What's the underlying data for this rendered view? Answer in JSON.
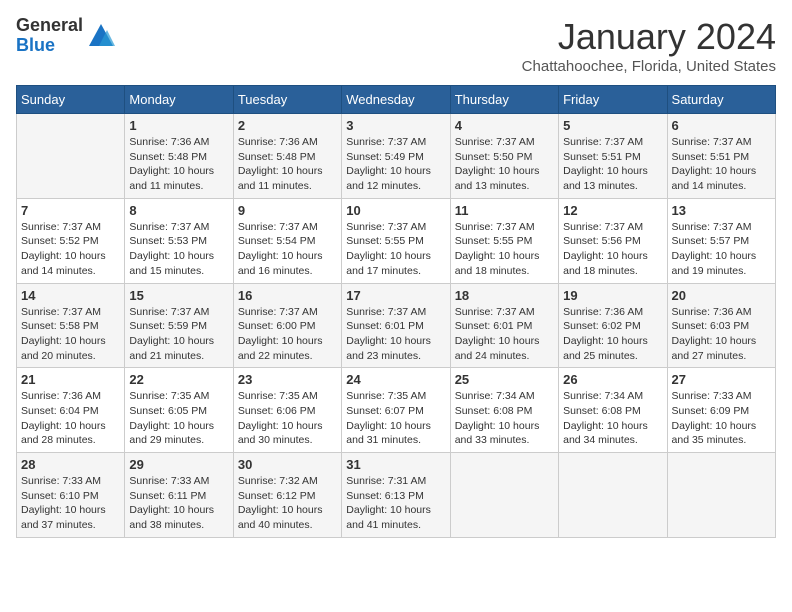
{
  "logo": {
    "general": "General",
    "blue": "Blue"
  },
  "title": "January 2024",
  "location": "Chattahoochee, Florida, United States",
  "days_of_week": [
    "Sunday",
    "Monday",
    "Tuesday",
    "Wednesday",
    "Thursday",
    "Friday",
    "Saturday"
  ],
  "weeks": [
    [
      {
        "day": "",
        "info": ""
      },
      {
        "day": "1",
        "info": "Sunrise: 7:36 AM\nSunset: 5:48 PM\nDaylight: 10 hours\nand 11 minutes."
      },
      {
        "day": "2",
        "info": "Sunrise: 7:36 AM\nSunset: 5:48 PM\nDaylight: 10 hours\nand 11 minutes."
      },
      {
        "day": "3",
        "info": "Sunrise: 7:37 AM\nSunset: 5:49 PM\nDaylight: 10 hours\nand 12 minutes."
      },
      {
        "day": "4",
        "info": "Sunrise: 7:37 AM\nSunset: 5:50 PM\nDaylight: 10 hours\nand 13 minutes."
      },
      {
        "day": "5",
        "info": "Sunrise: 7:37 AM\nSunset: 5:51 PM\nDaylight: 10 hours\nand 13 minutes."
      },
      {
        "day": "6",
        "info": "Sunrise: 7:37 AM\nSunset: 5:51 PM\nDaylight: 10 hours\nand 14 minutes."
      }
    ],
    [
      {
        "day": "7",
        "info": "Sunrise: 7:37 AM\nSunset: 5:52 PM\nDaylight: 10 hours\nand 14 minutes."
      },
      {
        "day": "8",
        "info": "Sunrise: 7:37 AM\nSunset: 5:53 PM\nDaylight: 10 hours\nand 15 minutes."
      },
      {
        "day": "9",
        "info": "Sunrise: 7:37 AM\nSunset: 5:54 PM\nDaylight: 10 hours\nand 16 minutes."
      },
      {
        "day": "10",
        "info": "Sunrise: 7:37 AM\nSunset: 5:55 PM\nDaylight: 10 hours\nand 17 minutes."
      },
      {
        "day": "11",
        "info": "Sunrise: 7:37 AM\nSunset: 5:55 PM\nDaylight: 10 hours\nand 18 minutes."
      },
      {
        "day": "12",
        "info": "Sunrise: 7:37 AM\nSunset: 5:56 PM\nDaylight: 10 hours\nand 18 minutes."
      },
      {
        "day": "13",
        "info": "Sunrise: 7:37 AM\nSunset: 5:57 PM\nDaylight: 10 hours\nand 19 minutes."
      }
    ],
    [
      {
        "day": "14",
        "info": "Sunrise: 7:37 AM\nSunset: 5:58 PM\nDaylight: 10 hours\nand 20 minutes."
      },
      {
        "day": "15",
        "info": "Sunrise: 7:37 AM\nSunset: 5:59 PM\nDaylight: 10 hours\nand 21 minutes."
      },
      {
        "day": "16",
        "info": "Sunrise: 7:37 AM\nSunset: 6:00 PM\nDaylight: 10 hours\nand 22 minutes."
      },
      {
        "day": "17",
        "info": "Sunrise: 7:37 AM\nSunset: 6:01 PM\nDaylight: 10 hours\nand 23 minutes."
      },
      {
        "day": "18",
        "info": "Sunrise: 7:37 AM\nSunset: 6:01 PM\nDaylight: 10 hours\nand 24 minutes."
      },
      {
        "day": "19",
        "info": "Sunrise: 7:36 AM\nSunset: 6:02 PM\nDaylight: 10 hours\nand 25 minutes."
      },
      {
        "day": "20",
        "info": "Sunrise: 7:36 AM\nSunset: 6:03 PM\nDaylight: 10 hours\nand 27 minutes."
      }
    ],
    [
      {
        "day": "21",
        "info": "Sunrise: 7:36 AM\nSunset: 6:04 PM\nDaylight: 10 hours\nand 28 minutes."
      },
      {
        "day": "22",
        "info": "Sunrise: 7:35 AM\nSunset: 6:05 PM\nDaylight: 10 hours\nand 29 minutes."
      },
      {
        "day": "23",
        "info": "Sunrise: 7:35 AM\nSunset: 6:06 PM\nDaylight: 10 hours\nand 30 minutes."
      },
      {
        "day": "24",
        "info": "Sunrise: 7:35 AM\nSunset: 6:07 PM\nDaylight: 10 hours\nand 31 minutes."
      },
      {
        "day": "25",
        "info": "Sunrise: 7:34 AM\nSunset: 6:08 PM\nDaylight: 10 hours\nand 33 minutes."
      },
      {
        "day": "26",
        "info": "Sunrise: 7:34 AM\nSunset: 6:08 PM\nDaylight: 10 hours\nand 34 minutes."
      },
      {
        "day": "27",
        "info": "Sunrise: 7:33 AM\nSunset: 6:09 PM\nDaylight: 10 hours\nand 35 minutes."
      }
    ],
    [
      {
        "day": "28",
        "info": "Sunrise: 7:33 AM\nSunset: 6:10 PM\nDaylight: 10 hours\nand 37 minutes."
      },
      {
        "day": "29",
        "info": "Sunrise: 7:33 AM\nSunset: 6:11 PM\nDaylight: 10 hours\nand 38 minutes."
      },
      {
        "day": "30",
        "info": "Sunrise: 7:32 AM\nSunset: 6:12 PM\nDaylight: 10 hours\nand 40 minutes."
      },
      {
        "day": "31",
        "info": "Sunrise: 7:31 AM\nSunset: 6:13 PM\nDaylight: 10 hours\nand 41 minutes."
      },
      {
        "day": "",
        "info": ""
      },
      {
        "day": "",
        "info": ""
      },
      {
        "day": "",
        "info": ""
      }
    ]
  ]
}
